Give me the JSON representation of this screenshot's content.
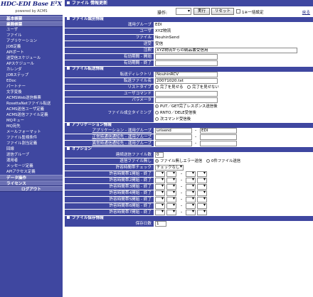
{
  "sidebar": {
    "logo_title": "HDC-EDI Base E²X",
    "logo_sub": "powered by ACMS",
    "groups_top": [
      "基本帳票",
      "業務帳票"
    ],
    "items": [
      "ユーザ",
      "ファイル",
      "アプリケーション",
      "JOB定義",
      "APIポート",
      "送受信スケジュール",
      "APスケジュール",
      "カレンダ",
      "JOBステップ",
      "EDoc",
      "パートナー",
      "文字変換",
      "ACMSWeb送信帳票",
      "RosettaNetファイル転送",
      "ACMS送信ユーザ定義",
      "ACMS送信ファイル定義",
      "MQキュー",
      "MQ宛先",
      "メールフォーマット",
      "ファイル監視条件",
      "ファイル割当定義",
      "回線",
      "送信グループ",
      "運用者",
      "メッセージ定義",
      "APIアクセス定義"
    ],
    "groups_bottom": [
      "データ操作",
      "ライセンス"
    ],
    "logout": "ログアウト"
  },
  "header": {
    "title": "ファイル 情報更新",
    "op_label": "操作:",
    "op_value": "",
    "exec": "実行",
    "reset": "リセット",
    "one_line_label": "1※一括設定",
    "back": "戻る"
  },
  "sections": {
    "file_id": "ファイル識別情報",
    "transfer": "ファイル転送情報",
    "app": "アプリケーション情報",
    "option": "オプション",
    "retention": "ファイル保存情報"
  },
  "file_id": {
    "app_group_label": "運用グループ",
    "app_group": "EDI",
    "user_label": "ユーザ",
    "user": "XYZ物流",
    "file_label": "ファイル",
    "file": "NouhinSend",
    "direction_label": "送受",
    "direction": "受信",
    "note_label": "注釈",
    "note": "XYZ物流からの納品書受信用",
    "valid_from_label": "有効期間 - 開始",
    "valid_to_label": "有効期間 - 終了"
  },
  "transfer": {
    "dir_label": "転送ディレクトリ",
    "dir": "NouhinRCV",
    "name_label": "転送ファイル名",
    "name": "20071020.txt",
    "listtype_label": "リストタイプ",
    "listtype_opt1": "完了を見せる",
    "listtype_opt2": "完了を見せない",
    "user_cmd_label": "ユーザコマンド",
    "param_label": "パラメータ",
    "timing_label": "ファイル成立タイミング",
    "timing_opt1": "PUT／GET完了レスポンス送信後",
    "timing_opt2": "RNTO／DELE受信後",
    "timing_opt3": "次コマンド受信後"
  },
  "app": {
    "normal_label": "アプリケーション - 運用グループ",
    "normal_value": "urisend",
    "normal_group": "EDI",
    "abnormal1_label": "正常時通信通知先 - 運用グループ",
    "abnormal2_label": "異常時通信通知先 - 運用グループ"
  },
  "option": {
    "retry_label": "連続送信ファイル数",
    "retry_value": "0",
    "nofile_label": "送信ファイル無し",
    "nofile_opt1": "ファイル無しエラー送信",
    "nofile_opt2": "0件ファイル送信",
    "check_label": "許容時間帯チェック",
    "check_value": "チェックなし",
    "windows": [
      "許容時間帯1開始 - 終了",
      "許容時間帯2開始 - 終了",
      "許容時間帯3開始 - 終了",
      "許容時間帯4開始 - 終了",
      "許容時間帯5開始 - 終了",
      "許容時間帯6開始 - 終了",
      "許容時間帯7開始 - 終了"
    ]
  },
  "retention": {
    "days_label": "保存日数",
    "days_value": "1"
  }
}
